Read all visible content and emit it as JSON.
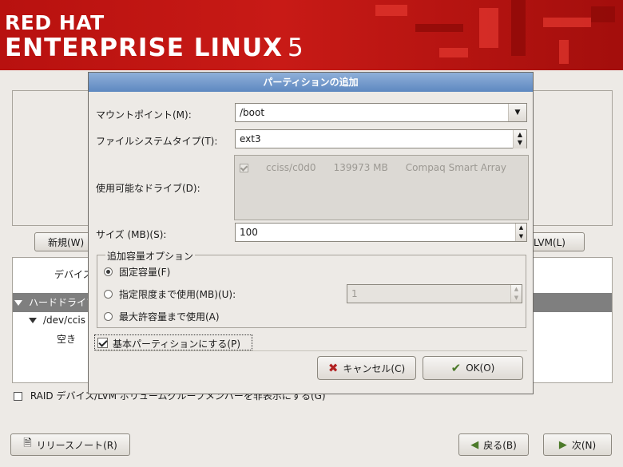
{
  "banner": {
    "line1": "RED HAT",
    "line2": "ENTERPRISE LINUX",
    "version": "5",
    "color": "#c81a16"
  },
  "background": {
    "new_button": "新規(W)",
    "lvm_button": "LVM(L)",
    "tree_header": "デバイス",
    "tree_rows": [
      "ハードドライブ",
      "/dev/ccis",
      "空き"
    ],
    "raid_checkbox_label": "RAID デバイス/LVM ボリュームグループメンバーを非表示にする(G)"
  },
  "dialog": {
    "title": "パーティションの追加",
    "title_color": "#6e93c8",
    "mount_point_label": "マウントポイント(M):",
    "mount_point_value": "/boot",
    "fs_type_label": "ファイルシステムタイプ(T):",
    "fs_type_value": "ext3",
    "drives_label": "使用可能なドライブ(D):",
    "drive": {
      "name": "cciss/c0d0",
      "size": "139973 MB",
      "model": "Compaq Smart Array"
    },
    "size_label": "サイズ (MB)(S):",
    "size_value": "100",
    "options_legend": "追加容量オプション",
    "opt_fixed": "固定容量(F)",
    "opt_limit": "指定限度まで使用(MB)(U):",
    "opt_limit_value": "1",
    "opt_max": "最大許容量まで使用(A)",
    "primary_label": "基本パーティションにする(P)",
    "cancel_button": "キャンセル(C)",
    "ok_button": "OK(O)"
  },
  "footer": {
    "release_notes": "リリースノート(R)",
    "back": "戻る(B)",
    "next": "次(N)"
  }
}
